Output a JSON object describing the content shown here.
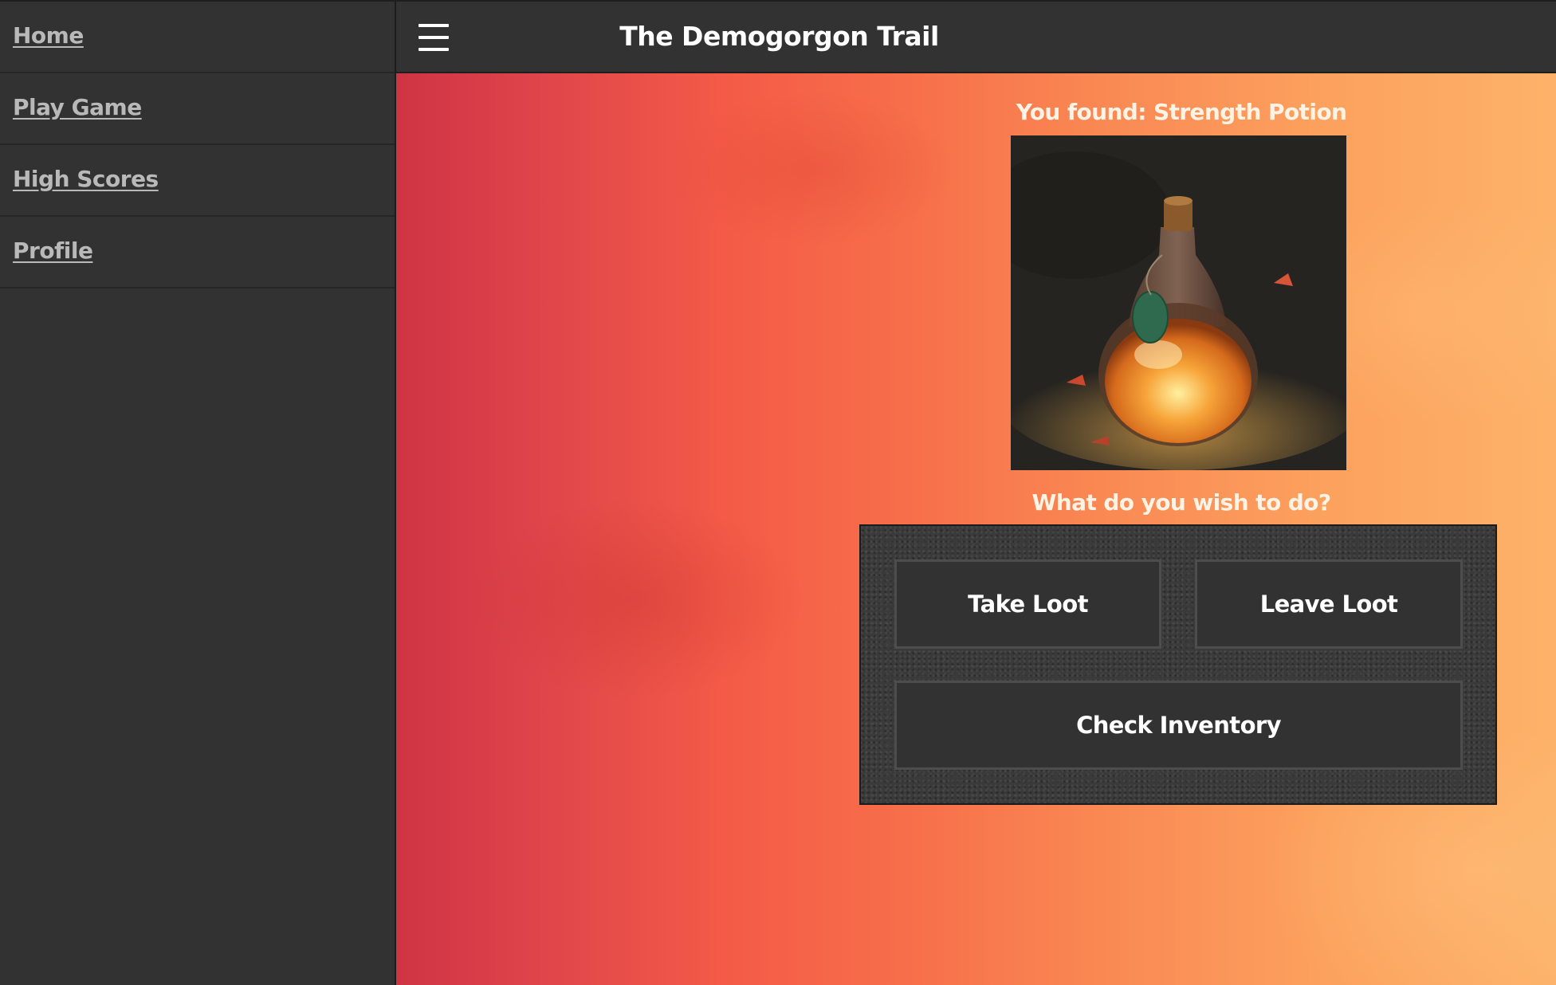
{
  "sidebar": {
    "items": [
      {
        "label": "Home"
      },
      {
        "label": "Play Game"
      },
      {
        "label": "High Scores"
      },
      {
        "label": "Profile"
      }
    ]
  },
  "header": {
    "title": "The Demogorgon Trail",
    "menu_icon": "hamburger-menu-icon"
  },
  "main": {
    "found_text": "You found: Strength Potion",
    "item_image": "strength-potion-image",
    "prompt_text": "What do you wish to do?",
    "actions": {
      "take_label": "Take Loot",
      "leave_label": "Leave Loot",
      "inventory_label": "Check Inventory"
    }
  },
  "colors": {
    "panel_bg": "#323232",
    "text_light": "#ffffff",
    "nav_link": "#b9b9b9",
    "bg_gradient_left": "#cf3444",
    "bg_gradient_right": "#fdb26a"
  }
}
